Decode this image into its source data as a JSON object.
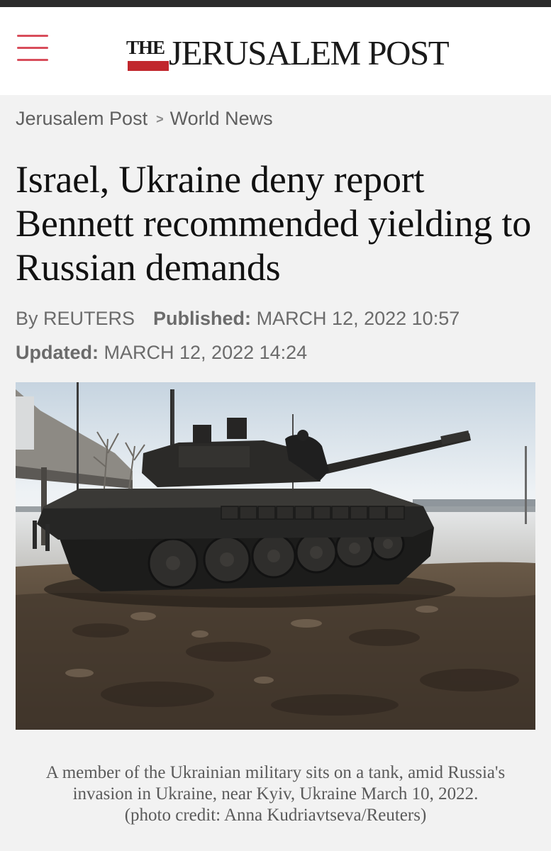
{
  "header": {
    "menu_icon": "hamburger-menu-icon",
    "logo": {
      "the": "THE",
      "name": "JERUSALEM POST"
    },
    "accent_color": "#c1272d"
  },
  "breadcrumb": {
    "items": [
      "Jerusalem Post",
      "World News"
    ],
    "separator": ">"
  },
  "article": {
    "title": "Israel, Ukraine deny report Bennett recommended yielding to Russian demands",
    "byline": {
      "by_text": "By REUTERS",
      "published_label": "Published:",
      "published_value": "MARCH 12, 2022 10:57",
      "updated_label": "Updated:",
      "updated_value": "MARCH 12, 2022 14:24"
    },
    "image": {
      "caption": "A member of the Ukrainian military sits on a tank, amid Russia's invasion in Ukraine, near Kyiv, Ukraine March 10, 2022.",
      "credit": "(photo credit: Anna Kudriavtseva/Reuters)"
    }
  }
}
